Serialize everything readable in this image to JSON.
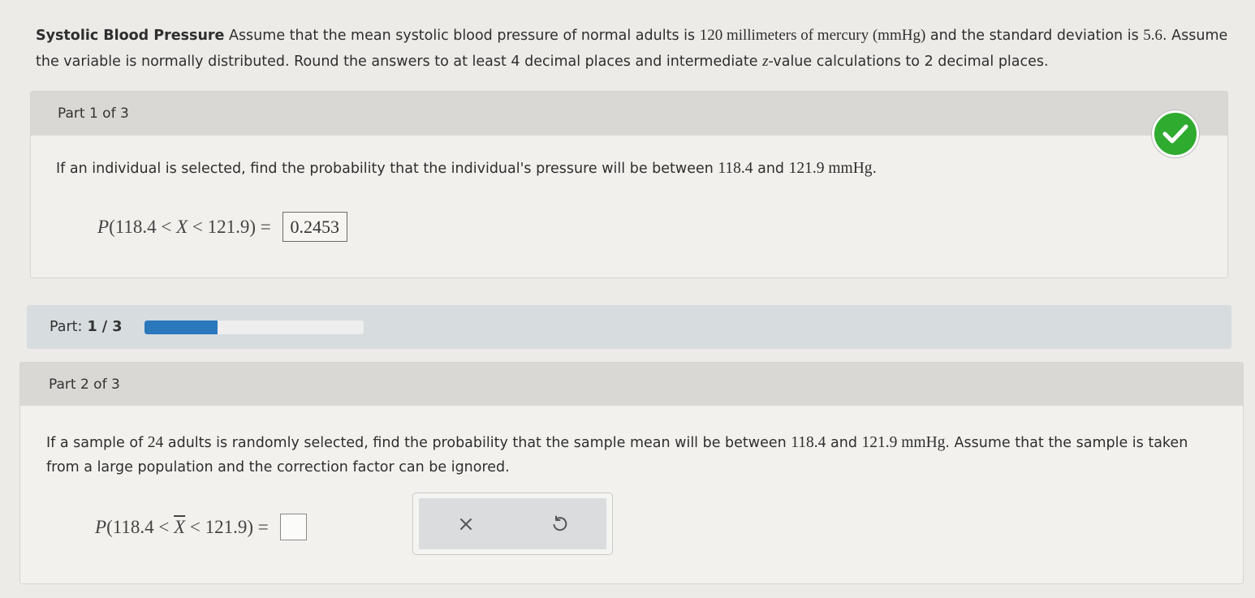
{
  "problem": {
    "title": "Systolic Blood Pressure",
    "text_a": " Assume that the mean systolic blood pressure of normal adults is ",
    "mean": "120 millimeters of mercury (mmHg)",
    "text_b": " and the standard deviation is ",
    "sd": "5.6",
    "text_c": ". Assume the variable is normally distributed. Round the answers to at least 4 decimal places and intermediate ",
    "z": "z",
    "text_d": "-value calculations to 2 decimal places."
  },
  "part1": {
    "header": "Part 1 of 3",
    "question_a": "If an individual is selected, find the probability that the individual's pressure will be between ",
    "low": "118.4",
    "question_and": " and ",
    "high": "121.9 mmHg",
    "question_end": ".",
    "eq_p": "P",
    "eq_inner_a": "(118.4 < ",
    "eq_var": "X",
    "eq_inner_b": " < 121.9)",
    "eq_sign": " = ",
    "answer": "0.2453",
    "status": "correct"
  },
  "progress": {
    "label": "Part:",
    "value": "1 / 3",
    "fraction": 0.333
  },
  "part2": {
    "header": "Part 2 of 3",
    "question_a": "If a sample of ",
    "n": "24",
    "question_b": " adults is randomly selected, find the probability that the sample mean will be between ",
    "low": "118.4",
    "question_and": " and ",
    "high": "121.9 mmHg",
    "question_c": ". Assume that the sample is taken from a large population and the correction factor can be ignored.",
    "eq_p": "P",
    "eq_inner_a": "(118.4 < ",
    "eq_var": "X",
    "eq_inner_b": " < 121.9)",
    "eq_sign": " = ",
    "answer": ""
  },
  "actions": {
    "clear_icon": "close-icon",
    "undo_icon": "undo-icon"
  },
  "colors": {
    "check": "#2fab2f",
    "progress": "#2b78bd"
  }
}
